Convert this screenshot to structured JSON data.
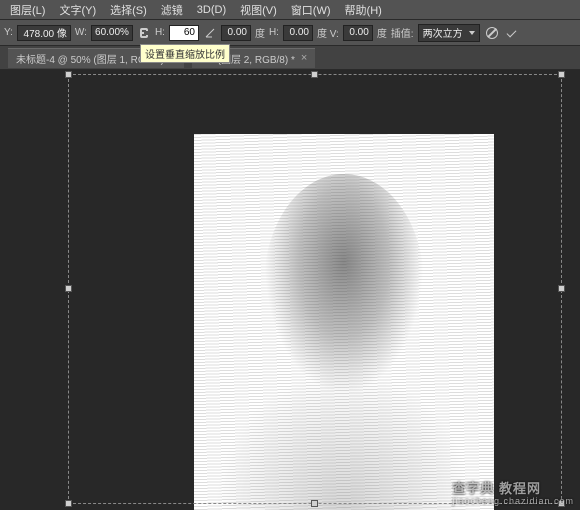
{
  "menu": {
    "items": [
      "图层(L)",
      "文字(Y)",
      "选择(S)",
      "滤镜",
      "3D(D)",
      "视图(V)",
      "窗口(W)",
      "帮助(H)"
    ]
  },
  "options": {
    "y_label": "Y:",
    "y_value": "478.00 像",
    "w_label": "W:",
    "w_value": "60.00%",
    "h_label": "H:",
    "h_value": "60",
    "angle_value": "0.00",
    "angle_unit": "度",
    "h2_label": "H:",
    "h2_value": "0.00",
    "v_label": "度   V:",
    "v_value": "0.00",
    "v_unit": "度",
    "interp_label": "插值:",
    "interp_value": "两次立方"
  },
  "tabs": [
    {
      "label": "未标题-4 @ 50% (图层 1, RGB/8)"
    },
    {
      "label": "7% (图层 2, RGB/8) *"
    }
  ],
  "tooltip": "设置垂直缩放比例",
  "watermark": {
    "main": "查字典 教程网",
    "sub": "jiaocheng.chazidian.com"
  }
}
